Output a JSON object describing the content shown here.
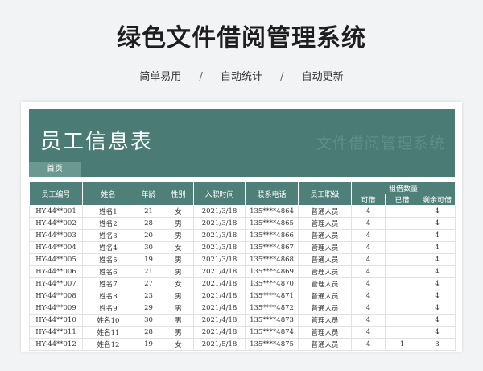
{
  "header": {
    "title": "绿色文件借阅管理系统",
    "features": [
      "简单易用",
      "自动统计",
      "自动更新"
    ],
    "separator": "/"
  },
  "sheet": {
    "banner_title": "员工信息表",
    "banner_watermark": "文件借阅管理系统",
    "home_tab": "首页",
    "columns": {
      "id": "员工编号",
      "name": "姓名",
      "age": "年龄",
      "gender": "性别",
      "hire_date": "入职时间",
      "phone": "联系电话",
      "level": "员工职级",
      "borrow_group": "租借数量",
      "can_borrow": "可借",
      "borrowed": "已借",
      "remaining": "剩余可借"
    },
    "rows": [
      {
        "id": "HY-44**001",
        "name": "姓名1",
        "age": "21",
        "gender": "女",
        "hire_date": "2021/3/18",
        "phone": "135****4864",
        "level": "普通人员",
        "can_borrow": "4",
        "borrowed": "",
        "remaining": "4"
      },
      {
        "id": "HY-44**002",
        "name": "姓名2",
        "age": "28",
        "gender": "男",
        "hire_date": "2021/3/18",
        "phone": "135****4865",
        "level": "管理人员",
        "can_borrow": "4",
        "borrowed": "",
        "remaining": "4"
      },
      {
        "id": "HY-44**003",
        "name": "姓名3",
        "age": "20",
        "gender": "男",
        "hire_date": "2021/3/18",
        "phone": "135****4866",
        "level": "普通人员",
        "can_borrow": "4",
        "borrowed": "",
        "remaining": "4"
      },
      {
        "id": "HY-44**004",
        "name": "姓名4",
        "age": "30",
        "gender": "女",
        "hire_date": "2021/3/18",
        "phone": "135****4867",
        "level": "管理人员",
        "can_borrow": "4",
        "borrowed": "",
        "remaining": "4"
      },
      {
        "id": "HY-44**005",
        "name": "姓名5",
        "age": "19",
        "gender": "男",
        "hire_date": "2021/3/18",
        "phone": "135****4868",
        "level": "普通人员",
        "can_borrow": "4",
        "borrowed": "",
        "remaining": "4"
      },
      {
        "id": "HY-44**006",
        "name": "姓名6",
        "age": "21",
        "gender": "男",
        "hire_date": "2021/4/18",
        "phone": "135****4869",
        "level": "管理人员",
        "can_borrow": "4",
        "borrowed": "",
        "remaining": "4"
      },
      {
        "id": "HY-44**007",
        "name": "姓名7",
        "age": "27",
        "gender": "女",
        "hire_date": "2021/4/18",
        "phone": "135****4870",
        "level": "管理人员",
        "can_borrow": "4",
        "borrowed": "",
        "remaining": "4"
      },
      {
        "id": "HY-44**008",
        "name": "姓名8",
        "age": "23",
        "gender": "男",
        "hire_date": "2021/4/18",
        "phone": "135****4871",
        "level": "普通人员",
        "can_borrow": "4",
        "borrowed": "",
        "remaining": "4"
      },
      {
        "id": "HY-44**009",
        "name": "姓名9",
        "age": "29",
        "gender": "男",
        "hire_date": "2021/4/18",
        "phone": "135****4872",
        "level": "普通人员",
        "can_borrow": "4",
        "borrowed": "",
        "remaining": "4"
      },
      {
        "id": "HY-44**010",
        "name": "姓名10",
        "age": "30",
        "gender": "男",
        "hire_date": "2021/4/18",
        "phone": "135****4873",
        "level": "管理人员",
        "can_borrow": "4",
        "borrowed": "",
        "remaining": "4"
      },
      {
        "id": "HY-44**011",
        "name": "姓名11",
        "age": "28",
        "gender": "男",
        "hire_date": "2021/4/18",
        "phone": "135****4874",
        "level": "管理人员",
        "can_borrow": "4",
        "borrowed": "",
        "remaining": "4"
      },
      {
        "id": "HY-44**012",
        "name": "姓名12",
        "age": "19",
        "gender": "女",
        "hire_date": "2021/5/18",
        "phone": "135****4875",
        "level": "普通人员",
        "can_borrow": "4",
        "borrowed": "1",
        "remaining": "3"
      }
    ]
  },
  "colors": {
    "primary": "#4a7b75",
    "header_cell": "#4f7f79",
    "tab": "#6b9891",
    "background": "#f2f3f5"
  }
}
